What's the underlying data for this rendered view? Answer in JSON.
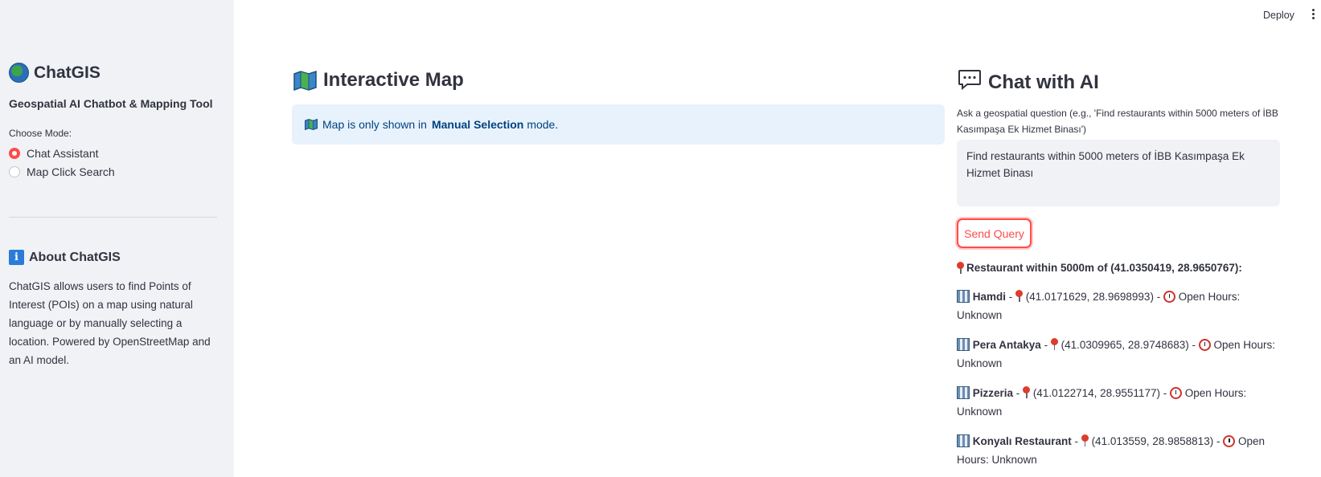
{
  "topbar": {
    "deploy_label": "Deploy"
  },
  "sidebar": {
    "app_title": "ChatGIS",
    "subtitle": "Geospatial AI Chatbot & Mapping Tool",
    "mode_label": "Choose Mode:",
    "modes": [
      {
        "label": "Chat Assistant",
        "selected": true
      },
      {
        "label": "Map Click Search",
        "selected": false
      }
    ],
    "about_title": "About ChatGIS",
    "about_text": "ChatGIS allows users to find Points of Interest (POIs) on a map using natural language or by manually selecting a location. Powered by OpenStreetMap and an AI model."
  },
  "map_panel": {
    "title": "Interactive Map",
    "info_prefix": "Map is only shown in",
    "info_bold": "Manual Selection",
    "info_suffix": "mode."
  },
  "chat_panel": {
    "title": "Chat with AI",
    "prompt_label": "Ask a geospatial question (e.g., 'Find restaurants within 5000 meters of İBB Kasımpaşa Ek Hizmet Binası')",
    "query_value": "Find restaurants within 5000 meters of İBB Kasımpaşa Ek Hizmet Binası",
    "send_label": "Send Query",
    "results_heading": "Restaurant within 5000m of (41.0350419, 28.9650767):",
    "results": [
      {
        "name": "Hamdi",
        "coords": "(41.0171629, 28.9698993)",
        "hours_label": "Open Hours:",
        "hours": "Unknown"
      },
      {
        "name": "Pera Antakya",
        "coords": "(41.0309965, 28.9748683)",
        "hours_label": "Open Hours:",
        "hours": "Unknown"
      },
      {
        "name": "Pizzeria",
        "coords": "(41.0122714, 28.9551177)",
        "hours_label": "Open Hours:",
        "hours": "Unknown"
      },
      {
        "name": "Konyalı Restaurant",
        "coords": "(41.013559, 28.9858813)",
        "hours_label": "Open Hours:",
        "hours": "Unknown"
      }
    ]
  },
  "colors": {
    "accent": "#ff4b4b",
    "sidebar_bg": "#f0f2f6",
    "info_bg": "#e8f2fc",
    "info_text": "#004280"
  },
  "icons": [
    "globe-icon",
    "info-icon",
    "map-icon",
    "speech-bubble-icon",
    "pin-icon",
    "building-icon",
    "alarm-clock-icon",
    "kebab-menu-icon"
  ]
}
